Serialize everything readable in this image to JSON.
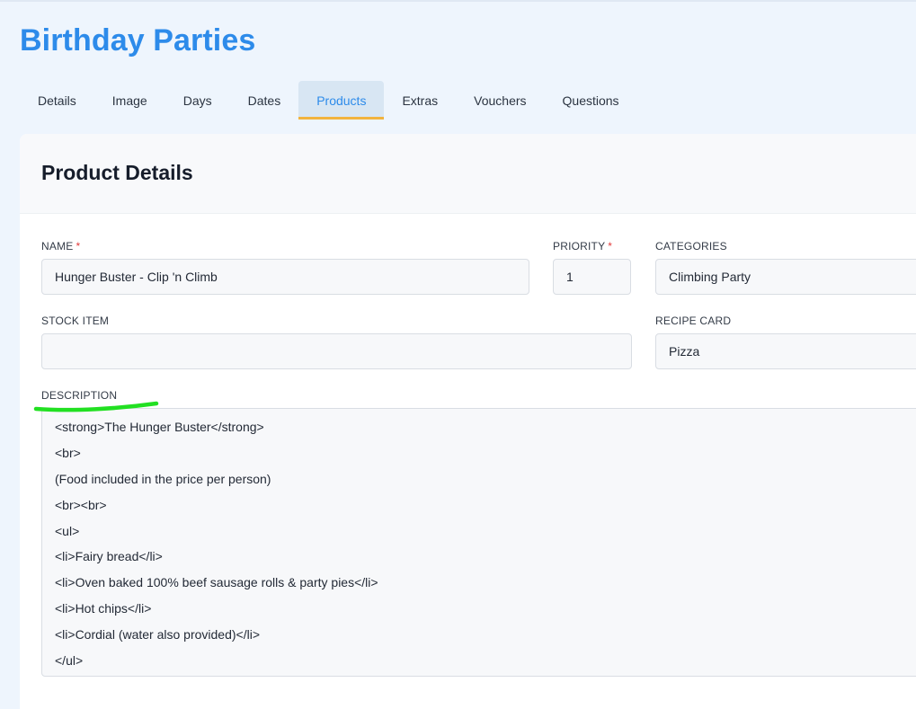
{
  "page": {
    "title": "Birthday Parties"
  },
  "tabs": [
    {
      "label": "Details",
      "active": false
    },
    {
      "label": "Image",
      "active": false
    },
    {
      "label": "Days",
      "active": false
    },
    {
      "label": "Dates",
      "active": false
    },
    {
      "label": "Products",
      "active": true
    },
    {
      "label": "Extras",
      "active": false
    },
    {
      "label": "Vouchers",
      "active": false
    },
    {
      "label": "Questions",
      "active": false
    }
  ],
  "card": {
    "title": "Product Details"
  },
  "form": {
    "name": {
      "label": "NAME",
      "required_mark": "*",
      "value": "Hunger Buster - Clip 'n Climb"
    },
    "priority": {
      "label": "PRIORITY",
      "required_mark": "*",
      "value": "1"
    },
    "categories": {
      "label": "CATEGORIES",
      "value": "Climbing Party"
    },
    "stock_item": {
      "label": "STOCK ITEM",
      "value": ""
    },
    "recipe_card": {
      "label": "RECIPE CARD",
      "value": "Pizza"
    },
    "description": {
      "label": "DESCRIPTION",
      "lines": [
        "<strong>The Hunger Buster</strong>",
        "<br>",
        "(Food included in the price per person)",
        "<br><br>",
        "<ul>",
        "<li>Fairy bread</li>",
        "<li>Oven baked 100% beef sausage rolls & party pies</li>",
        "<li>Hot chips</li>",
        "<li>Cordial (water also provided)</li>",
        "</ul>"
      ]
    }
  },
  "colors": {
    "accent": "#2d8bea",
    "tab_underline": "#f2b33d",
    "required": "#e23b3b",
    "annotation": "#22e022"
  }
}
